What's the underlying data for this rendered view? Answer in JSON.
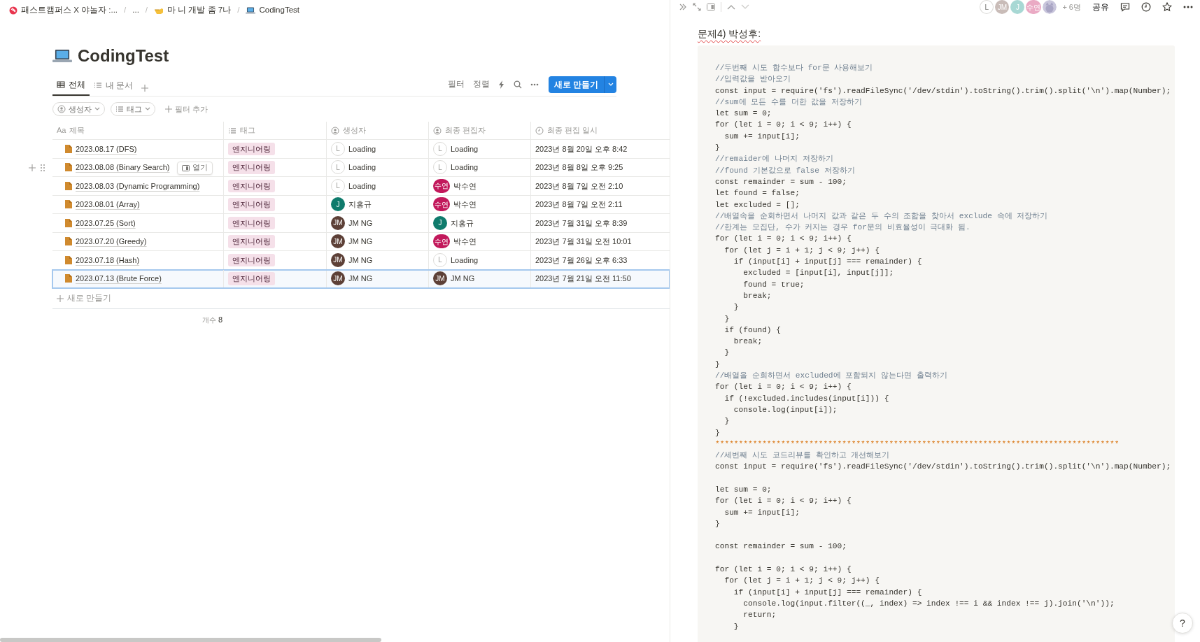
{
  "breadcrumb": [
    {
      "label": "패스트캠퍼스 X 야놀자 :..."
    },
    {
      "separator": "/",
      "label": "..."
    },
    {
      "separator": "/",
      "label": "마 니 개발 좀 7나"
    },
    {
      "separator": "/",
      "label": "CodingTest"
    }
  ],
  "page": {
    "title": "CodingTest"
  },
  "views": [
    {
      "label": "전체",
      "selected": true
    },
    {
      "label": "내 문서",
      "selected": false
    }
  ],
  "toolbar": {
    "filter": "필터",
    "sort": "정렬",
    "new_button": "새로 만들기"
  },
  "filters": [
    {
      "label": "생성자"
    },
    {
      "label": "태그"
    }
  ],
  "add_filter": "필터 추가",
  "table": {
    "columns": [
      {
        "kind": "title",
        "prefix": "Aa",
        "label": "제목"
      },
      {
        "kind": "tag",
        "label": "태그"
      },
      {
        "kind": "person",
        "label": "생성자"
      },
      {
        "kind": "person",
        "label": "최종 편집자"
      },
      {
        "kind": "date",
        "label": "최종 편집 일시"
      }
    ],
    "rows": [
      {
        "title": "2023.08.17 (DFS)",
        "tag": "엔지니어링",
        "creator": {
          "initials": "L",
          "name": "Loading",
          "color": "#ffffff"
        },
        "editor": {
          "initials": "L",
          "name": "Loading",
          "color": "#ffffff"
        },
        "edited": "2023년 8월 20일 오후 8:42",
        "selected": false,
        "hovered": false
      },
      {
        "title": "2023.08.08 (Binary Search)",
        "tag": "엔지니어링",
        "creator": {
          "initials": "L",
          "name": "Loading",
          "color": "#ffffff"
        },
        "editor": {
          "initials": "L",
          "name": "Loading",
          "color": "#ffffff"
        },
        "edited": "2023년 8월 8일 오후 9:25",
        "selected": false,
        "hovered": true,
        "open_label": "열기"
      },
      {
        "title": "2023.08.03 (Dynamic Programming)",
        "tag": "엔지니어링",
        "creator": {
          "initials": "L",
          "name": "Loading",
          "color": "#ffffff"
        },
        "editor": {
          "initials": "수연",
          "name": "박수연",
          "color": "#c2185b"
        },
        "edited": "2023년 8월 7일 오전 2:10",
        "selected": false,
        "hovered": false
      },
      {
        "title": "2023.08.01 (Array)",
        "tag": "엔지니어링",
        "creator": {
          "initials": "J",
          "name": "지홍규",
          "color": "#0f7b6c"
        },
        "editor": {
          "initials": "수연",
          "name": "박수연",
          "color": "#c2185b"
        },
        "edited": "2023년 8월 7일 오전 2:11",
        "selected": false,
        "hovered": false
      },
      {
        "title": "2023.07.25 (Sort)",
        "tag": "엔지니어링",
        "creator": {
          "initials": "JM",
          "name": "JM NG",
          "color": "#5d4037"
        },
        "editor": {
          "initials": "J",
          "name": "지홍규",
          "color": "#0f7b6c"
        },
        "edited": "2023년 7월 31일 오후 8:39",
        "selected": false,
        "hovered": false
      },
      {
        "title": "2023.07.20 (Greedy)",
        "tag": "엔지니어링",
        "creator": {
          "initials": "JM",
          "name": "JM NG",
          "color": "#5d4037"
        },
        "editor": {
          "initials": "수연",
          "name": "박수연",
          "color": "#c2185b"
        },
        "edited": "2023년 7월 31일 오전 10:01",
        "selected": false,
        "hovered": false
      },
      {
        "title": "2023.07.18 (Hash)",
        "tag": "엔지니어링",
        "creator": {
          "initials": "JM",
          "name": "JM NG",
          "color": "#5d4037"
        },
        "editor": {
          "initials": "L",
          "name": "Loading",
          "color": "#ffffff"
        },
        "edited": "2023년 7월 26일 오후 6:33",
        "selected": false,
        "hovered": false
      },
      {
        "title": "2023.07.13 (Brute Force)",
        "tag": "엔지니어링",
        "creator": {
          "initials": "JM",
          "name": "JM NG",
          "color": "#5d4037"
        },
        "editor": {
          "initials": "JM",
          "name": "JM NG",
          "color": "#5d4037"
        },
        "edited": "2023년 7월 21일 오전 11:50",
        "selected": true,
        "hovered": false
      }
    ],
    "new_row": "새로 만들기",
    "count": {
      "label": "개수",
      "value": "8"
    }
  },
  "topbar": {
    "avatars": [
      {
        "kind": "initials",
        "initials": "L",
        "color": "#ffffff"
      },
      {
        "kind": "initials",
        "initials": "JM",
        "color": "#c9bcb8"
      },
      {
        "kind": "initials",
        "initials": "J",
        "color": "#a8d8d4"
      },
      {
        "kind": "initials",
        "initials": "수연",
        "color": "#eaaac4"
      },
      {
        "kind": "picture"
      }
    ],
    "more_people": "+ 6명",
    "share": "공유"
  },
  "document": {
    "heading": "문제4) 박성후:",
    "code": [
      {
        "kind": "comment",
        "text": "//두번째 시도 함수보다 for문 사용해보기"
      },
      {
        "kind": "comment",
        "text": "//입력값을 받아오기"
      },
      {
        "kind": "code",
        "text": "const input = require('fs').readFileSync('/dev/stdin').toString().trim().split('\\n').map(Number);"
      },
      {
        "kind": "comment",
        "text": "//sum에 모든 수를 더한 값을 저장하기"
      },
      {
        "kind": "code",
        "text": "let sum = 0;"
      },
      {
        "kind": "code",
        "text": "for (let i = 0; i < 9; i++) {"
      },
      {
        "kind": "code",
        "text": "  sum += input[i];"
      },
      {
        "kind": "code",
        "text": "}"
      },
      {
        "kind": "comment",
        "text": "//remaider에 나머지 저장하기"
      },
      {
        "kind": "comment",
        "text": "//found 기본값으로 false 저장하기"
      },
      {
        "kind": "code",
        "text": "const remainder = sum - 100;"
      },
      {
        "kind": "code",
        "text": "let found = false;"
      },
      {
        "kind": "code",
        "text": "let excluded = [];"
      },
      {
        "kind": "comment",
        "text": "//배열속을 순회하면서 나머지 값과 같은 두 수의 조합을 찾아서 exclude 속에 저장하기"
      },
      {
        "kind": "comment",
        "text": "//한계는 모집단, 수가 커지는 경우 for문의 비효율성이 극대화 됨."
      },
      {
        "kind": "code",
        "text": "for (let i = 0; i < 9; i++) {"
      },
      {
        "kind": "code",
        "text": "  for (let j = i + 1; j < 9; j++) {"
      },
      {
        "kind": "code",
        "text": "    if (input[i] + input[j] === remainder) {"
      },
      {
        "kind": "code",
        "text": "      excluded = [input[i], input[j]];"
      },
      {
        "kind": "code",
        "text": "      found = true;"
      },
      {
        "kind": "code",
        "text": "      break;"
      },
      {
        "kind": "code",
        "text": "    }"
      },
      {
        "kind": "code",
        "text": "  }"
      },
      {
        "kind": "code",
        "text": "  if (found) {"
      },
      {
        "kind": "code",
        "text": "    break;"
      },
      {
        "kind": "code",
        "text": "  }"
      },
      {
        "kind": "code",
        "text": "}"
      },
      {
        "kind": "comment",
        "text": "//배열을 순회하면서 excluded에 포함되지 않는다면 출력하기"
      },
      {
        "kind": "code",
        "text": "for (let i = 0; i < 9; i++) {"
      },
      {
        "kind": "code",
        "text": "  if (!excluded.includes(input[i])) {"
      },
      {
        "kind": "code",
        "text": "    console.log(input[i]);"
      },
      {
        "kind": "code",
        "text": "  }"
      },
      {
        "kind": "code",
        "text": "}"
      },
      {
        "kind": "separator",
        "text": "**************************************************************************************"
      },
      {
        "kind": "comment",
        "text": "//세번째 시도 코드리뷰를 확인하고 개선해보기"
      },
      {
        "kind": "code",
        "text": "const input = require('fs').readFileSync('/dev/stdin').toString().trim().split('\\n').map(Number);"
      },
      {
        "kind": "blank"
      },
      {
        "kind": "code",
        "text": "let sum = 0;"
      },
      {
        "kind": "code",
        "text": "for (let i = 0; i < 9; i++) {"
      },
      {
        "kind": "code",
        "text": "  sum += input[i];"
      },
      {
        "kind": "code",
        "text": "}"
      },
      {
        "kind": "blank"
      },
      {
        "kind": "code",
        "text": "const remainder = sum - 100;"
      },
      {
        "kind": "blank"
      },
      {
        "kind": "code",
        "text": "for (let i = 0; i < 9; i++) {"
      },
      {
        "kind": "code",
        "text": "  for (let j = i + 1; j < 9; j++) {"
      },
      {
        "kind": "code",
        "text": "    if (input[i] + input[j] === remainder) {"
      },
      {
        "kind": "code",
        "text": "      console.log(input.filter((_, index) => index !== i && index !== j).join('\\n'));"
      },
      {
        "kind": "code",
        "text": "      return;"
      },
      {
        "kind": "code",
        "text": "    }"
      }
    ]
  },
  "help": "?"
}
